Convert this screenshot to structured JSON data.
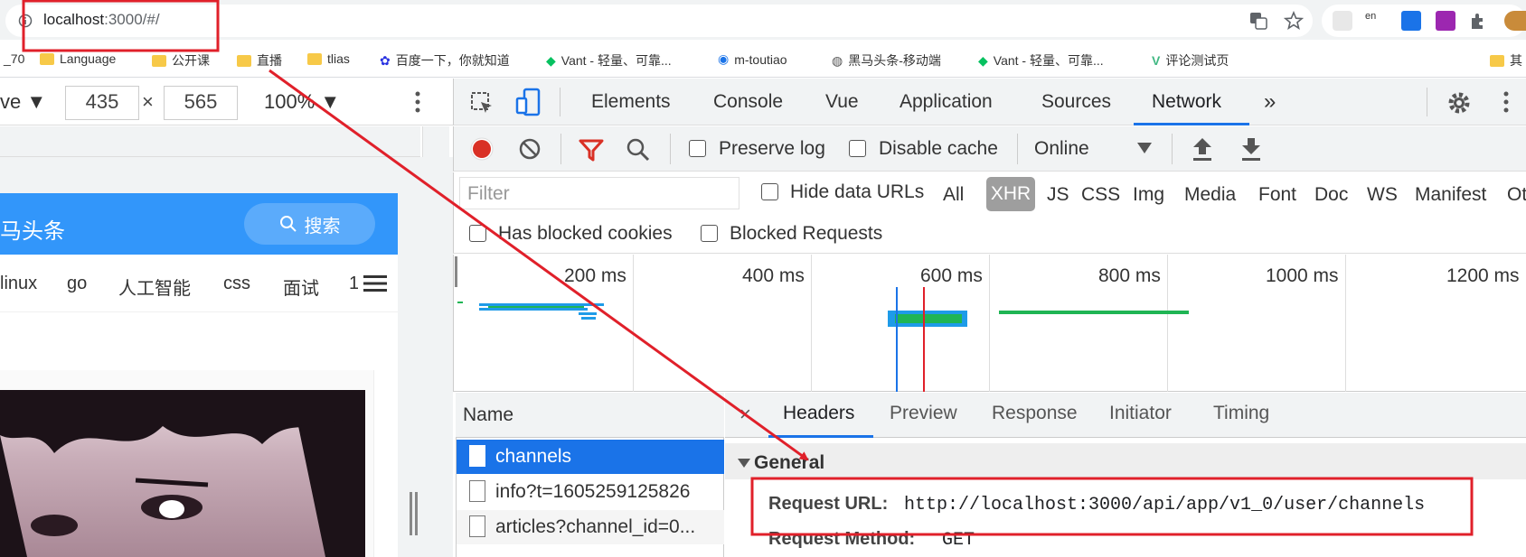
{
  "browser": {
    "url_host": "localhost",
    "url_rest": ":3000/#/",
    "bookmarks": [
      "_70",
      "Language",
      "公开课",
      "直播",
      "tlias",
      "百度一下，你就知道",
      "Vant - 轻量、可靠...",
      "m-toutiao",
      "黑马头条-移动端",
      "Vant - 轻量、可靠...",
      "评论测试页",
      "其"
    ]
  },
  "device_toolbar": {
    "device": "ve ▼",
    "width": "435",
    "times": "×",
    "height": "565",
    "zoom": "100% ▼"
  },
  "mobile_app": {
    "title": "马头条",
    "search_label": "搜索",
    "channels": [
      "linux",
      "go",
      "人工智能",
      "css",
      "面试",
      "1"
    ]
  },
  "devtools": {
    "tabs": [
      "Elements",
      "Console",
      "Vue",
      "Application",
      "Sources",
      "Network"
    ],
    "active_tab": "Network",
    "more_tabs": "»",
    "toolbar": {
      "preserve_log": "Preserve log",
      "disable_cache": "Disable cache",
      "throttle": "Online"
    },
    "filter": {
      "placeholder": "Filter",
      "hide_data_urls": "Hide data URLs",
      "types": [
        "All",
        "XHR",
        "JS",
        "CSS",
        "Img",
        "Media",
        "Font",
        "Doc",
        "WS",
        "Manifest",
        "Ot"
      ],
      "active_type": "XHR",
      "has_blocked_cookies": "Has blocked cookies",
      "blocked_requests": "Blocked Requests"
    },
    "overview_ticks": [
      "200 ms",
      "400 ms",
      "600 ms",
      "800 ms",
      "1000 ms",
      "1200 ms"
    ],
    "requests": {
      "header": "Name",
      "items": [
        "channels",
        "info?t=1605259125826",
        "articles?channel_id=0..."
      ],
      "selected": "channels"
    },
    "detail": {
      "close": "×",
      "tabs": [
        "Headers",
        "Preview",
        "Response",
        "Initiator",
        "Timing"
      ],
      "active_tab": "Headers",
      "section": "General",
      "request_url_label": "Request URL:",
      "request_url": "http://localhost:3000/api/app/v1_0/user/channels",
      "request_method_label": "Request Method:",
      "request_method": "GET"
    }
  },
  "colors": {
    "accent_blue": "#1a73e8",
    "app_header": "#3296fa",
    "annotation_red": "#e0202a",
    "record_red": "#d93025"
  }
}
